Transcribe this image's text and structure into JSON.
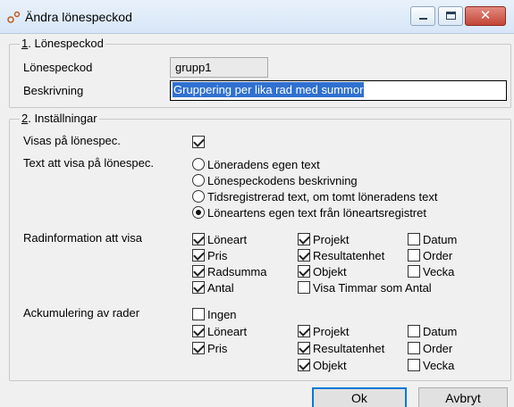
{
  "window": {
    "title": "Ändra lönespeckod",
    "close_glyph": "✕"
  },
  "section1": {
    "number": "1",
    "title": ". Lönespeckod",
    "code_label": "Lönespeckod",
    "code_value": "grupp1",
    "desc_label": "Beskrivning",
    "desc_value": "Gruppering per lika rad med summor"
  },
  "section2": {
    "number": "2",
    "title": ". Inställningar",
    "show_label": "Visas på lönespec.",
    "show_checked": true,
    "text_label": "Text att visa på lönespec.",
    "text_options": [
      {
        "label": "Löneradens egen text",
        "selected": false
      },
      {
        "label": "Lönespeckodens beskrivning",
        "selected": false
      },
      {
        "label": "Tidsregistrerad text, om tomt löneradens text",
        "selected": false
      },
      {
        "label": "Löneartens egen text från löneartsregistret",
        "selected": true
      }
    ],
    "row_info_label": "Radinformation att visa",
    "row_info": {
      "loneart": {
        "label": "Löneart",
        "checked": true
      },
      "pris": {
        "label": "Pris",
        "checked": true
      },
      "radsumma": {
        "label": "Radsumma",
        "checked": true
      },
      "antal": {
        "label": "Antal",
        "checked": true
      },
      "projekt": {
        "label": "Projekt",
        "checked": true
      },
      "resultatenhet": {
        "label": "Resultatenhet",
        "checked": true
      },
      "objekt": {
        "label": "Objekt",
        "checked": true
      },
      "visa_timmar": {
        "label": "Visa Timmar som Antal",
        "checked": false
      },
      "datum": {
        "label": "Datum",
        "checked": false
      },
      "order": {
        "label": "Order",
        "checked": false
      },
      "vecka": {
        "label": "Vecka",
        "checked": false
      }
    },
    "accum_label": "Ackumulering av rader",
    "accum": {
      "ingen": {
        "label": "Ingen",
        "checked": false
      },
      "loneart": {
        "label": "Löneart",
        "checked": true
      },
      "pris": {
        "label": "Pris",
        "checked": true
      },
      "projekt": {
        "label": "Projekt",
        "checked": true
      },
      "resultatenhet": {
        "label": "Resultatenhet",
        "checked": true
      },
      "objekt": {
        "label": "Objekt",
        "checked": true
      },
      "datum": {
        "label": "Datum",
        "checked": false
      },
      "order": {
        "label": "Order",
        "checked": false
      },
      "vecka": {
        "label": "Vecka",
        "checked": false
      }
    }
  },
  "buttons": {
    "ok": "Ok",
    "cancel": "Avbryt"
  }
}
